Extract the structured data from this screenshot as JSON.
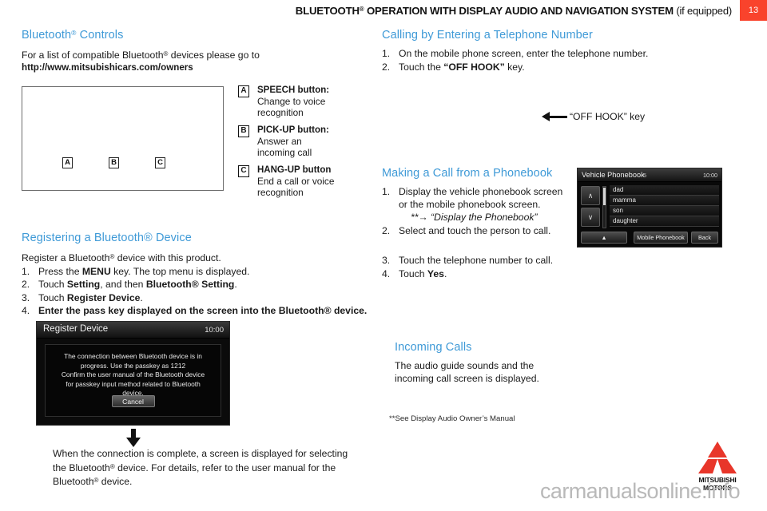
{
  "header": {
    "title_main": "BLUETOOTH",
    "title_sup": "®",
    "title_rest": " OPERATION WITH DISPLAY AUDIO AND NAVIGATION SYSTEM",
    "title_note": " (if equipped)",
    "page_number": "13",
    "badge_color": "#f9432c",
    "accent_color": "#3f9ad7"
  },
  "bluetooth_controls": {
    "heading": "Bluetooth",
    "heading_sup": "®",
    "heading_rest": " Controls",
    "intro": "For a list of compatible Bluetooth",
    "intro_sup": "®",
    "intro_rest": " devices please go to",
    "url": "http://www.mitsubishicars.com/owners",
    "diagram_markers": [
      "A",
      "B",
      "C"
    ],
    "legend": [
      {
        "marker": "A",
        "title": "SPEECH button:",
        "desc_line1": "Change to voice",
        "desc_line2": "recognition"
      },
      {
        "marker": "B",
        "title": "PICK-UP button:",
        "desc_line1": "Answer an",
        "desc_line2": "incoming call"
      },
      {
        "marker": "C",
        "title": "HANG-UP button",
        "desc_line1": "End a call or voice",
        "desc_line2": "recognition"
      }
    ]
  },
  "registering": {
    "heading": "Registering a Bluetooth® Device",
    "intro": "Register a Bluetooth",
    "intro_sup": "®",
    "intro_rest": " device with this product.",
    "steps": [
      {
        "num": "1.",
        "pre": "Press the ",
        "bold": "MENU",
        "post": " key. The top menu is displayed."
      },
      {
        "num": "2.",
        "pre": "Touch ",
        "bold": "Setting",
        "post": ", and then ",
        "bold2": "Bluetooth® Setting",
        "post2": "."
      },
      {
        "num": "3.",
        "pre": "Touch ",
        "bold": "Register Device",
        "post": "."
      },
      {
        "num": "4.",
        "all_bold": "Enter the pass key displayed on the screen into the Bluetooth® device."
      }
    ],
    "screenshot": {
      "title": "Register Device",
      "clock": "10:00",
      "message_line1": "The connection between Bluetooth device is in",
      "message_line2": "progress. Use the passkey as 1212",
      "message_line3": "Confirm the user manual of the Bluetooth device",
      "message_line4": "for passkey input method related to Bluetooth",
      "message_line5": "device.",
      "cancel_label": "Cancel"
    },
    "after_line1": "When the connection is complete, a screen is displayed for selecting",
    "after_line2": "the Bluetooth",
    "after_line2_rest": " device. For details, refer to the user manual for the",
    "after_line3": "Bluetooth",
    "after_line3_rest": " device."
  },
  "calling": {
    "heading": "Calling by Entering a Telephone Number",
    "steps": [
      {
        "num": "1.",
        "text": "On the mobile phone screen, enter the telephone number."
      },
      {
        "num": "2.",
        "pre": "Touch the ",
        "bold": "“OFF HOOK”",
        "post": " key."
      }
    ],
    "annotation": "“OFF HOOK” key"
  },
  "phonebook": {
    "heading": "Making a Call from a Phonebook",
    "steps": [
      {
        "num": "1.",
        "line1": "Display the vehicle phonebook screen",
        "line2": "or the mobile phonebook screen."
      },
      {
        "num": "2.",
        "text": "Select and touch the person to call."
      },
      {
        "num": "3.",
        "text": "Touch the telephone number to call."
      },
      {
        "num": "4.",
        "pre": "Touch ",
        "bold": "Yes",
        "post": "."
      }
    ],
    "reference": "**→ “Display the Phonebook”",
    "screenshot": {
      "title": "Vehicle Phonebook",
      "count": "5",
      "clock": "10:00",
      "entries": [
        "dad",
        "mamma",
        "son",
        "daughter"
      ],
      "up_arrow": "▲",
      "nav_up": "∧",
      "nav_down": "∨",
      "btn_mobile": "Mobile Phonebook",
      "btn_back": "Back"
    }
  },
  "incoming": {
    "heading": "Incoming Calls",
    "line1": "The audio guide sounds and the",
    "line2": "incoming call screen is displayed."
  },
  "footnote": "**See Display Audio Owner’s Manual",
  "logo": {
    "line1": "MITSUBISHI",
    "line2": "MOTORS"
  },
  "watermark": "carmanualsonline.info"
}
